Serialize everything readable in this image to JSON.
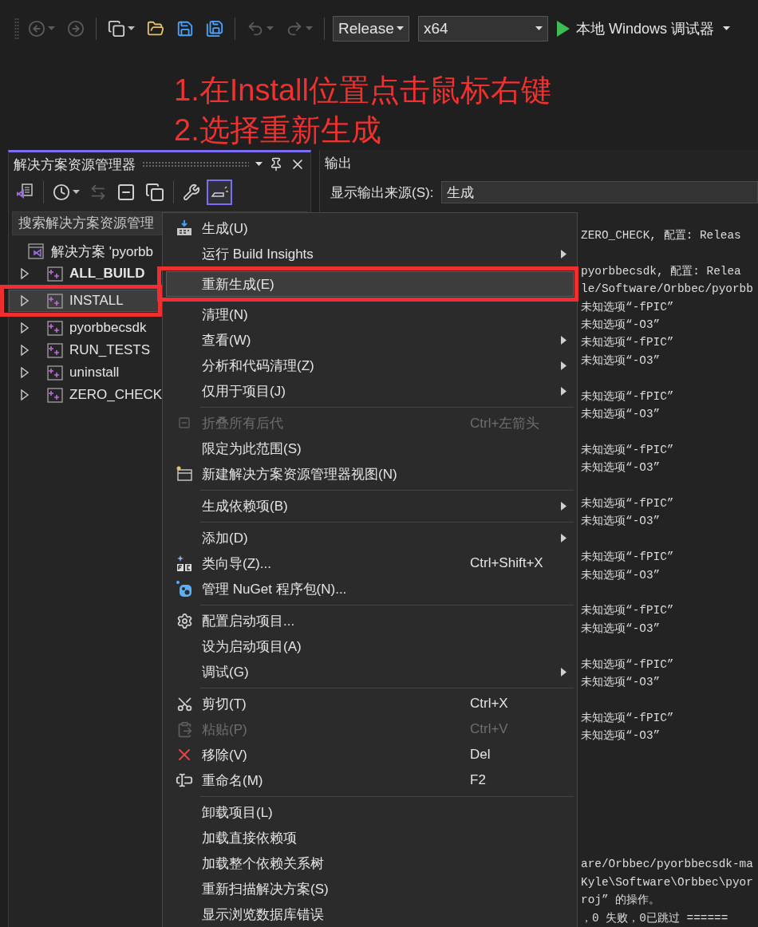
{
  "toolbar": {
    "buttons": [
      {
        "kind": "back",
        "disabled": true,
        "has_menu": true
      },
      {
        "kind": "forward",
        "disabled": true,
        "has_menu": false
      },
      {
        "kind": "separator"
      },
      {
        "kind": "new-item",
        "disabled": false,
        "has_menu": true
      },
      {
        "kind": "open",
        "disabled": false,
        "has_menu": false
      },
      {
        "kind": "save",
        "disabled": false,
        "has_menu": false
      },
      {
        "kind": "save-all",
        "disabled": false,
        "has_menu": false
      },
      {
        "kind": "separator"
      },
      {
        "kind": "undo",
        "disabled": true,
        "has_menu": true
      },
      {
        "kind": "redo",
        "disabled": true,
        "has_menu": true
      },
      {
        "kind": "separator"
      }
    ],
    "configuration": "Release",
    "platform": "x64",
    "debugger": "本地 Windows 调试器"
  },
  "annotation": {
    "steps": [
      "1.在Install位置点击鼠标右键",
      "2.选择重新生成"
    ]
  },
  "explorer": {
    "title": "解决方案资源管理器",
    "tools": [
      {
        "kind": "solution-view",
        "on": false,
        "disabled": false,
        "has_menu": false
      },
      {
        "kind": "separator"
      },
      {
        "kind": "history",
        "on": false,
        "disabled": false,
        "has_menu": true
      },
      {
        "kind": "sync",
        "on": false,
        "disabled": true,
        "has_menu": false
      },
      {
        "kind": "collapse",
        "on": false,
        "disabled": false,
        "has_menu": false
      },
      {
        "kind": "show-all",
        "on": false,
        "disabled": false,
        "has_menu": false
      },
      {
        "kind": "separator"
      },
      {
        "kind": "properties",
        "on": false,
        "disabled": false,
        "has_menu": false
      },
      {
        "kind": "preview",
        "on": true,
        "disabled": false,
        "has_menu": false
      }
    ],
    "search": {
      "placeholder": "搜索解决方案资源管理"
    },
    "tree": [
      {
        "label": "解决方案 'pyorbb",
        "children": [
          {
            "label": "ALL_BUILD",
            "startup": true,
            "expanded": false,
            "selected": false,
            "annotated": false
          },
          {
            "label": "INSTALL",
            "startup": false,
            "expanded": false,
            "selected": true,
            "annotated": true
          },
          {
            "label": "pyorbbecsdk",
            "startup": false,
            "expanded": false,
            "selected": false,
            "annotated": false
          },
          {
            "label": "RUN_TESTS",
            "startup": false,
            "expanded": false,
            "selected": false,
            "annotated": false
          },
          {
            "label": "uninstall",
            "startup": false,
            "expanded": false,
            "selected": false,
            "annotated": false
          },
          {
            "label": "ZERO_CHECK",
            "startup": false,
            "expanded": false,
            "selected": false,
            "annotated": false
          }
        ]
      }
    ]
  },
  "output": {
    "title": "输出",
    "source_label": "显示输出来源(S):",
    "source": "生成",
    "blocks": [
      [
        "ZERO_CHECK, 配置: Releas"
      ],
      [
        "pyorbbecsdk, 配置: Relea",
        "le/Software/Orbbec/pyorbb",
        "未知选项“-fPIC”",
        "未知选项“-O3”",
        "未知选项“-fPIC”",
        "未知选项“-O3”"
      ],
      [
        "未知选项“-fPIC”",
        "未知选项“-O3”"
      ],
      [
        "未知选项“-fPIC”",
        "未知选项“-O3”"
      ],
      [
        "未知选项“-fPIC”",
        "未知选项“-O3”"
      ],
      [
        "未知选项“-fPIC”",
        "未知选项“-O3”"
      ],
      [
        "未知选项“-fPIC”",
        "未知选项“-O3”"
      ],
      [
        "未知选项“-fPIC”",
        "未知选项“-O3”"
      ],
      [
        "未知选项“-fPIC”",
        "未知选项“-O3”"
      ]
    ],
    "tail": [
      "are/Orbbec/pyorbbecsdk-ma",
      "Kyle\\Software\\Orbbec\\pyor",
      "roj” 的操作。",
      "，0 失败，0已跳过 ======"
    ]
  },
  "context_menu": [
    {
      "kind": "build",
      "label": "生成(U)",
      "submenu": false,
      "disabled": false,
      "selected": false,
      "annotated": false
    },
    {
      "kind": "plain",
      "label": "运行 Build Insights",
      "submenu": true,
      "disabled": false,
      "selected": false,
      "annotated": false
    },
    {
      "kind": "plain",
      "label": "重新生成(E)",
      "submenu": false,
      "disabled": false,
      "selected": true,
      "annotated": true
    },
    {
      "kind": "plain",
      "label": "清理(N)",
      "submenu": false,
      "disabled": false,
      "selected": false,
      "annotated": false
    },
    {
      "kind": "plain",
      "label": "查看(W)",
      "submenu": true,
      "disabled": false,
      "selected": false,
      "annotated": false
    },
    {
      "kind": "plain",
      "label": "分析和代码清理(Z)",
      "submenu": true,
      "disabled": false,
      "selected": false,
      "annotated": false
    },
    {
      "kind": "plain",
      "label": "仅用于项目(J)",
      "submenu": true,
      "disabled": false,
      "selected": false,
      "annotated": false
    },
    {
      "kind": "separator"
    },
    {
      "kind": "collapse",
      "label": "折叠所有后代",
      "shortcut": "Ctrl+左箭头",
      "submenu": false,
      "disabled": true,
      "selected": false,
      "annotated": false
    },
    {
      "kind": "plain",
      "label": "限定为此范围(S)",
      "submenu": false,
      "disabled": false,
      "selected": false,
      "annotated": false
    },
    {
      "kind": "new-view",
      "label": "新建解决方案资源管理器视图(N)",
      "submenu": false,
      "disabled": false,
      "selected": false,
      "annotated": false
    },
    {
      "kind": "separator"
    },
    {
      "kind": "plain",
      "label": "生成依赖项(B)",
      "submenu": true,
      "disabled": false,
      "selected": false,
      "annotated": false
    },
    {
      "kind": "separator"
    },
    {
      "kind": "plain",
      "label": "添加(D)",
      "submenu": true,
      "disabled": false,
      "selected": false,
      "annotated": false
    },
    {
      "kind": "class-wizard",
      "label": "类向导(Z)...",
      "shortcut": "Ctrl+Shift+X",
      "submenu": false,
      "disabled": false,
      "selected": false,
      "annotated": false
    },
    {
      "kind": "nuget",
      "label": "管理 NuGet 程序包(N)...",
      "submenu": false,
      "disabled": false,
      "selected": false,
      "annotated": false
    },
    {
      "kind": "separator"
    },
    {
      "kind": "gear",
      "label": "配置启动项目...",
      "submenu": false,
      "disabled": false,
      "selected": false,
      "annotated": false
    },
    {
      "kind": "plain",
      "label": "设为启动项目(A)",
      "submenu": false,
      "disabled": false,
      "selected": false,
      "annotated": false
    },
    {
      "kind": "plain",
      "label": "调试(G)",
      "submenu": true,
      "disabled": false,
      "selected": false,
      "annotated": false
    },
    {
      "kind": "separator"
    },
    {
      "kind": "cut",
      "label": "剪切(T)",
      "shortcut": "Ctrl+X",
      "submenu": false,
      "disabled": false,
      "selected": false,
      "annotated": false
    },
    {
      "kind": "paste",
      "label": "粘贴(P)",
      "shortcut": "Ctrl+V",
      "submenu": false,
      "disabled": true,
      "selected": false,
      "annotated": false
    },
    {
      "kind": "remove",
      "label": "移除(V)",
      "shortcut": "Del",
      "submenu": false,
      "disabled": false,
      "selected": false,
      "annotated": false
    },
    {
      "kind": "rename",
      "label": "重命名(M)",
      "shortcut": "F2",
      "submenu": false,
      "disabled": false,
      "selected": false,
      "annotated": false
    },
    {
      "kind": "separator"
    },
    {
      "kind": "plain",
      "label": "卸载项目(L)",
      "submenu": false,
      "disabled": false,
      "selected": false,
      "annotated": false
    },
    {
      "kind": "plain",
      "label": "加载直接依赖项",
      "submenu": false,
      "disabled": false,
      "selected": false,
      "annotated": false
    },
    {
      "kind": "plain",
      "label": "加载整个依赖关系树",
      "submenu": false,
      "disabled": false,
      "selected": false,
      "annotated": false
    },
    {
      "kind": "plain",
      "label": "重新扫描解决方案(S)",
      "submenu": false,
      "disabled": false,
      "selected": false,
      "annotated": false
    },
    {
      "kind": "plain",
      "label": "显示浏览数据库错误",
      "submenu": false,
      "disabled": false,
      "selected": false,
      "annotated": false
    }
  ]
}
